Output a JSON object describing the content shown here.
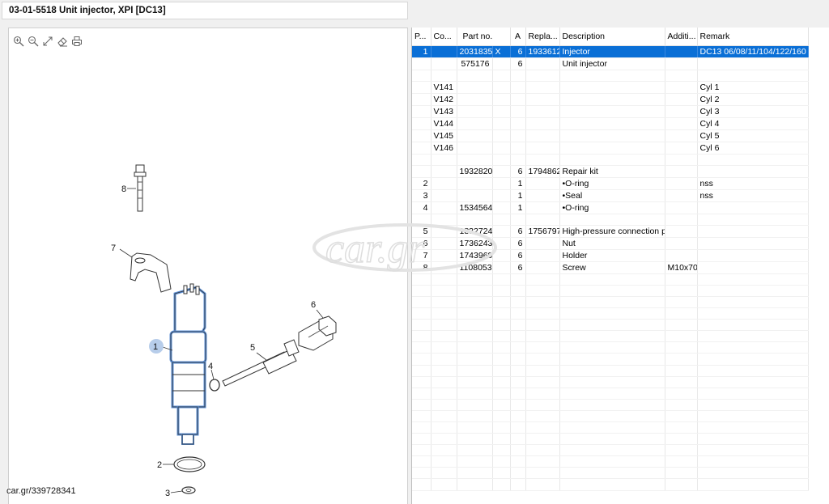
{
  "window": {
    "title": "03-01-5518 Unit injector, XPI [DC13]"
  },
  "toolbar": {
    "icons": [
      "zoom-in-icon",
      "zoom-out-icon",
      "expand-icon",
      "eraser-icon",
      "print-icon"
    ]
  },
  "diagram": {
    "callouts": [
      "1",
      "2",
      "3",
      "4",
      "5",
      "6",
      "7",
      "8"
    ],
    "highlight_color": "#5b8fd6"
  },
  "watermark": {
    "phone_text": "car.gr/339728341",
    "logo_text": "car.gr"
  },
  "table": {
    "headers": [
      "P...",
      "Co...",
      "Part no.",
      "A",
      "Repla...",
      "Description",
      "Additi...",
      "Remark"
    ],
    "rows": [
      [
        "1",
        "",
        "2031835",
        "X",
        "6",
        "1933612",
        "Injector",
        "",
        "DC13 06/08/11/104/122/160"
      ],
      [
        "",
        "",
        "575176",
        "",
        "6",
        "",
        "Unit injector",
        "",
        ""
      ],
      [
        "",
        "",
        "",
        "",
        "",
        "",
        "",
        "",
        ""
      ],
      [
        "",
        "V141",
        "",
        "",
        "",
        "",
        "",
        "",
        "Cyl 1"
      ],
      [
        "",
        "V142",
        "",
        "",
        "",
        "",
        "",
        "",
        "Cyl 2"
      ],
      [
        "",
        "V143",
        "",
        "",
        "",
        "",
        "",
        "",
        "Cyl 3"
      ],
      [
        "",
        "V144",
        "",
        "",
        "",
        "",
        "",
        "",
        "Cyl 4"
      ],
      [
        "",
        "V145",
        "",
        "",
        "",
        "",
        "",
        "",
        "Cyl 5"
      ],
      [
        "",
        "V146",
        "",
        "",
        "",
        "",
        "",
        "",
        "Cyl 6"
      ],
      [
        "",
        "",
        "",
        "",
        "",
        "",
        "",
        "",
        ""
      ],
      [
        "",
        "",
        "1932820",
        "",
        "6",
        "1794862",
        "Repair kit",
        "",
        ""
      ],
      [
        "2",
        "",
        "",
        "",
        "1",
        "",
        "•O-ring",
        "",
        "nss"
      ],
      [
        "3",
        "",
        "",
        "",
        "1",
        "",
        "•Seal",
        "",
        "nss"
      ],
      [
        "4",
        "",
        "1534564",
        "",
        "1",
        "",
        "•O-ring",
        "",
        ""
      ],
      [
        "",
        "",
        "",
        "",
        "",
        "",
        "",
        "",
        ""
      ],
      [
        "5",
        "",
        "1832724",
        "",
        "6",
        "1756797",
        "High-pressure connection pipe",
        "",
        ""
      ],
      [
        "6",
        "",
        "1736243",
        "",
        "6",
        "",
        "Nut",
        "",
        ""
      ],
      [
        "7",
        "",
        "1743969",
        "",
        "6",
        "",
        "Holder",
        "",
        ""
      ],
      [
        "8",
        "",
        "1108053",
        "",
        "6",
        "",
        "Screw",
        "M10x70",
        ""
      ],
      [
        "",
        "",
        "",
        "",
        "",
        "",
        "",
        "",
        ""
      ],
      [
        "",
        "",
        "",
        "",
        "",
        "",
        "",
        "",
        ""
      ],
      [
        "",
        "",
        "",
        "",
        "",
        "",
        "",
        "",
        ""
      ],
      [
        "",
        "",
        "",
        "",
        "",
        "",
        "",
        "",
        ""
      ],
      [
        "",
        "",
        "",
        "",
        "",
        "",
        "",
        "",
        ""
      ],
      [
        "",
        "",
        "",
        "",
        "",
        "",
        "",
        "",
        ""
      ],
      [
        "",
        "",
        "",
        "",
        "",
        "",
        "",
        "",
        ""
      ],
      [
        "",
        "",
        "",
        "",
        "",
        "",
        "",
        "",
        ""
      ],
      [
        "",
        "",
        "",
        "",
        "",
        "",
        "",
        "",
        ""
      ],
      [
        "",
        "",
        "",
        "",
        "",
        "",
        "",
        "",
        ""
      ],
      [
        "",
        "",
        "",
        "",
        "",
        "",
        "",
        "",
        ""
      ],
      [
        "",
        "",
        "",
        "",
        "",
        "",
        "",
        "",
        ""
      ],
      [
        "",
        "",
        "",
        "",
        "",
        "",
        "",
        "",
        ""
      ],
      [
        "",
        "",
        "",
        "",
        "",
        "",
        "",
        "",
        ""
      ],
      [
        "",
        "",
        "",
        "",
        "",
        "",
        "",
        "",
        ""
      ],
      [
        "",
        "",
        "",
        "",
        "",
        "",
        "",
        "",
        ""
      ],
      [
        "",
        "",
        "",
        "",
        "",
        "",
        "",
        "",
        ""
      ],
      [
        "",
        "",
        "",
        "",
        "",
        "",
        "",
        "",
        ""
      ],
      [
        "",
        "",
        "",
        "",
        "",
        "",
        "",
        "",
        ""
      ]
    ],
    "selected_row": 0,
    "selection_color": "#0a6fd6"
  }
}
